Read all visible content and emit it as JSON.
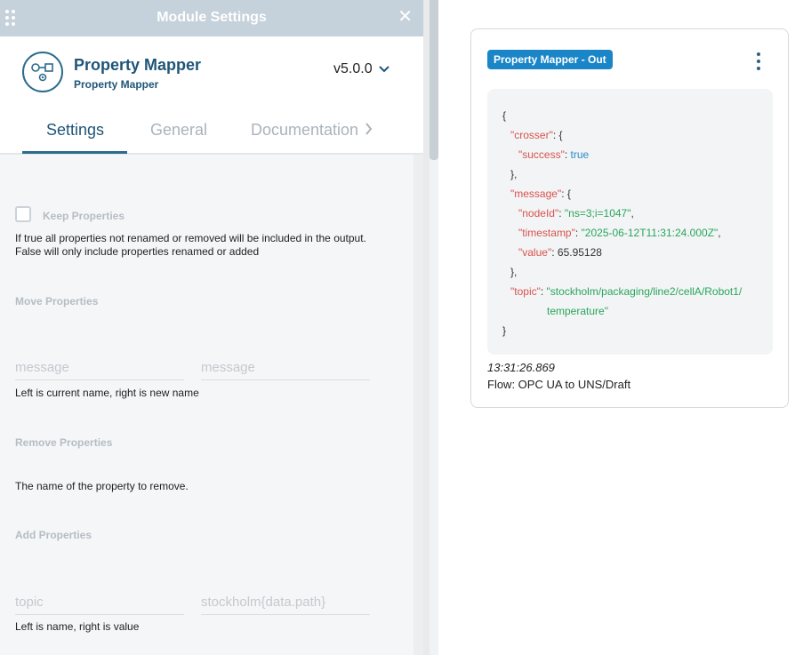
{
  "titlebar": {
    "title": "Module Settings",
    "close_icon": "✕"
  },
  "module": {
    "name": "Property Mapper",
    "type": "Property Mapper",
    "version": "v5.0.0"
  },
  "tabs": [
    "Settings",
    "General",
    "Documentation"
  ],
  "settings": {
    "keep_properties": {
      "label": "Keep Properties",
      "checked": false,
      "help_line1": "If true all properties not renamed or removed will be included in the output.",
      "help_line2": "False will only include properties renamed or added"
    },
    "move_properties": {
      "label": "Move Properties",
      "left_placeholder": "message",
      "right_placeholder": "message",
      "help": "Left is current name, right is new name"
    },
    "remove_properties": {
      "label": "Remove Properties",
      "help": "The name of the property to remove."
    },
    "add_properties": {
      "label": "Add Properties",
      "left_placeholder": "topic",
      "right_placeholder": "stockholm{data.path}",
      "help": "Left is name, right is value"
    }
  },
  "debug_card": {
    "badge": "Property Mapper - Out",
    "json_lines": [
      "{",
      "\"crosser\": {",
      "\"success\": true",
      "},",
      "\"message\": {",
      "\"nodeId\": \"ns=3;i=1047\",",
      "\"timestamp\": \"2025-06-12T11:31:24.000Z\",",
      "\"value\": 65.95128",
      "},",
      "\"topic\": \"stockholm/packaging/line2/cellA/Robot1/",
      "temperature\"",
      "}"
    ],
    "time": "13:31:26.869",
    "flow": "Flow: OPC UA to UNS/Draft"
  },
  "colors": {
    "accent": "#2c6b8e",
    "badge": "#1a86c8",
    "json_key": "#d9534f",
    "json_string": "#2aa65c",
    "json_bool": "#2a8bc8"
  },
  "icons": [
    "drag-handle-icon",
    "close-icon",
    "module-icon",
    "chevron-down-icon",
    "chevron-right-icon",
    "kebab-menu-icon"
  ]
}
